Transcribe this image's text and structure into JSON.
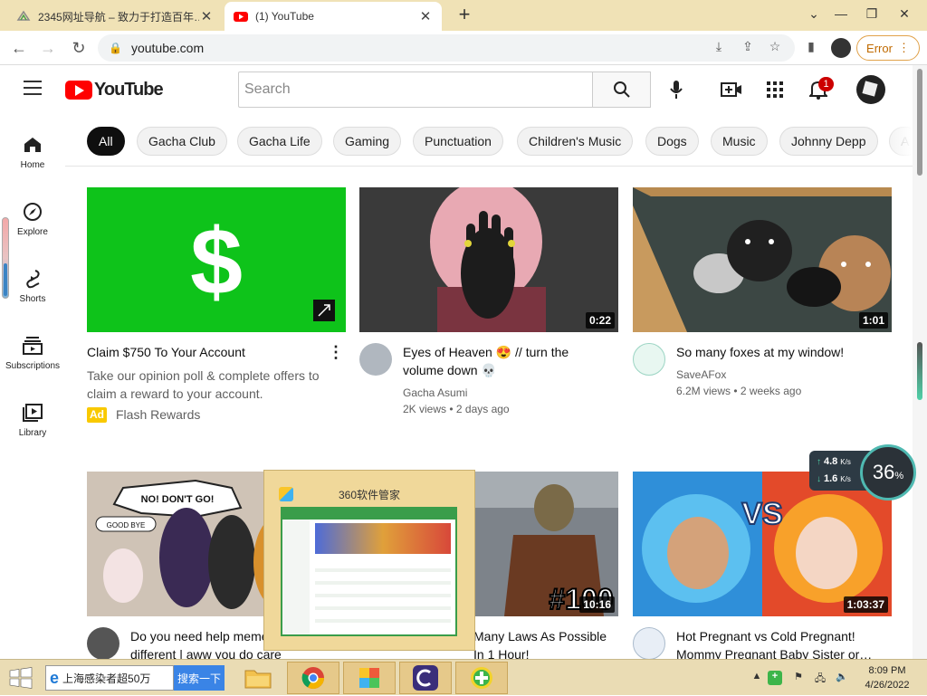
{
  "browser": {
    "tabs": [
      {
        "title": "2345网址导航 – 致力于打造百年…",
        "active": false
      },
      {
        "title": "(1) YouTube",
        "active": true
      }
    ],
    "new_tab": "+",
    "url": "youtube.com",
    "error_label": "Error"
  },
  "youtube": {
    "logo_text": "YouTube",
    "search_placeholder": "Search",
    "notification_count": "1",
    "chips": [
      "All",
      "Gacha Club",
      "Gacha Life",
      "Gaming",
      "Punctuation",
      "Children's Music",
      "Dogs",
      "Music",
      "Johnny Depp",
      "A"
    ],
    "sidebar": [
      {
        "label": "Home",
        "icon": "home-icon"
      },
      {
        "label": "Explore",
        "icon": "compass-icon"
      },
      {
        "label": "Shorts",
        "icon": "shorts-icon"
      },
      {
        "label": "Subscriptions",
        "icon": "subscriptions-icon"
      },
      {
        "label": "Library",
        "icon": "library-icon"
      }
    ],
    "videos": [
      {
        "title": "Claim $750 To Your Account",
        "description": "Take our opinion poll & complete offers to claim a reward to your account.",
        "ad_badge": "Ad",
        "channel": "Flash Rewards",
        "thumb": "cash-app-logo"
      },
      {
        "title": "Eyes of Heaven 😍 // turn the volume down 💀",
        "channel": "Gacha Asumi",
        "meta": "2K views • 2 days ago",
        "duration": "0:22"
      },
      {
        "title": "So many foxes at my window!",
        "channel": "SaveAFox",
        "meta": "6.2M views • 2 weeks ago",
        "duration": "1:01"
      },
      {
        "title": "Do you need help meme different | aww you do care me…",
        "thumb_texts": [
          "NO! DON'T GO!",
          "GOOD BYE"
        ]
      },
      {
        "title": "Many Laws As Possible In 1 Hour!",
        "duration": "10:16",
        "thumb_text": "#100"
      },
      {
        "title": "Hot Pregnant vs Cold Pregnant! Mommy Pregnant Baby Sister or…",
        "duration": "1:03:37",
        "thumb_text": "VS"
      }
    ]
  },
  "overlay": {
    "popup_title": "360软件管家",
    "speed_up": "4.8",
    "speed_down": "1.6",
    "speed_unit": "K/s",
    "gauge_value": "36",
    "gauge_unit": "%"
  },
  "taskbar": {
    "search_text": "上海感染者超50万",
    "search_button": "搜索一下",
    "time": "8:09 PM",
    "date": "4/26/2022"
  }
}
